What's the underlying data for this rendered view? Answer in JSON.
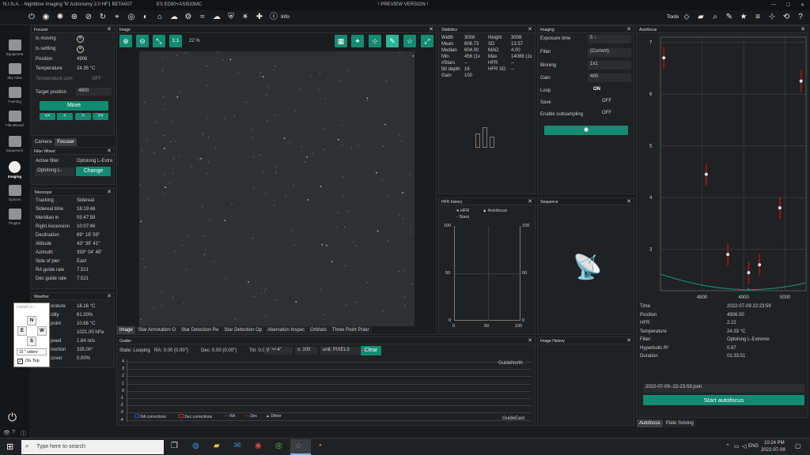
{
  "window": {
    "title": "N.I.N.A. - Nighttime Imaging 'N' Astronomy 2.0 HF1 BETA007",
    "profile": "ES ED80+ASI533MC",
    "banner": "! PREVIEW VERSION !"
  },
  "toolbar": {
    "info_label": "Info",
    "tools_label": "Tools"
  },
  "sidebar": {
    "items": [
      "Equipment",
      "Sky Atlas",
      "Framing",
      "Flat Wizard",
      "Sequencer",
      "Imaging",
      "Options",
      "Plugins"
    ]
  },
  "focuser": {
    "title": "Focuser",
    "rows": [
      {
        "label": "Is moving",
        "value": ""
      },
      {
        "label": "Is settling",
        "value": ""
      },
      {
        "label": "Position",
        "value": "4906"
      },
      {
        "label": "Temperature",
        "value": "24.35 °C"
      },
      {
        "label": "Temperature com",
        "value": "OFF"
      }
    ],
    "target_label": "Target position",
    "target_value": "4800",
    "move_label": "Move",
    "step_buttons": [
      "<<",
      "<",
      ">",
      ">>"
    ]
  },
  "device_tabs": [
    "Camera",
    "Focuser"
  ],
  "filter_wheel": {
    "title": "Filter Wheel",
    "active_label": "Active filter",
    "active_value": "Optolong L-Extre",
    "select_value": "Optolong L-",
    "change_label": "Change"
  },
  "telescope": {
    "title": "Telescope",
    "rows": [
      {
        "label": "Tracking",
        "value": "Sidereal"
      },
      {
        "label": "Sidereal time",
        "value": "16:19:48"
      },
      {
        "label": "Meridian in",
        "value": "05:47:59"
      },
      {
        "label": "Right Ascension",
        "value": "10:07:46"
      },
      {
        "label": "Declination",
        "value": "89° 19' 59\""
      },
      {
        "label": "Altitude",
        "value": "43° 39' 41\""
      },
      {
        "label": "Azimuth",
        "value": "359° 04' 45\""
      },
      {
        "label": "Side of pier",
        "value": "East"
      },
      {
        "label": "RA guide rate",
        "value": "7.521"
      },
      {
        "label": "Dec guide rate",
        "value": "7.521"
      }
    ]
  },
  "weather": {
    "title": "Weather",
    "rows": [
      {
        "label": "erature",
        "value": "18.16 °C"
      },
      {
        "label": "idity",
        "value": "61.00%"
      },
      {
        "label": "point",
        "value": "10.66 °C"
      },
      {
        "label": "",
        "value": "1021.00 hPa"
      },
      {
        "label": "peed",
        "value": "1.64 m/s"
      },
      {
        "label": "irection",
        "value": "335.00°"
      },
      {
        "label": "cover",
        "value": "0.00%"
      }
    ]
  },
  "handcontroller": {
    "title": "HandCo...",
    "buttons": [
      "N",
      "E",
      "W",
      "S"
    ],
    "rate": "15 \" sidere",
    "on_top": "On Top"
  },
  "image": {
    "title": "Image",
    "zoom_label": "1:1",
    "zoom_pct": "22 %",
    "tabs": [
      "Image",
      "Star Annotation O",
      "Star Detection Re",
      "Star Detection Op",
      "Aberration Inspec",
      "Orbitals",
      "Three Point Polar"
    ]
  },
  "statistics": {
    "title": "Statistics",
    "rows": [
      {
        "l1": "Width",
        "v1": "3008",
        "l2": "Height",
        "v2": "3008"
      },
      {
        "l1": "Mean",
        "v1": "606.73",
        "l2": "SD",
        "v2": "13.57"
      },
      {
        "l1": "Median",
        "v1": "604.00",
        "l2": "MAD",
        "v2": "4.00"
      },
      {
        "l1": "Min",
        "v1": "456 (1x",
        "l2": "Max",
        "v2": "14088 (1x"
      },
      {
        "l1": "#Stars",
        "v1": "--",
        "l2": "HFR",
        "v2": "--"
      },
      {
        "l1": "Bit depth",
        "v1": "16",
        "l2": "HFR SD",
        "v2": "--"
      },
      {
        "l1": "Gain",
        "v1": "100",
        "l2": "",
        "v2": ""
      }
    ]
  },
  "imaging": {
    "title": "Imaging",
    "exposure_label": "Exposure time",
    "exposure_value": "5",
    "exposure_unit": "s",
    "filter_label": "Filter",
    "filter_value": "(Current)",
    "binning_label": "Binning",
    "binning_value": "1x1",
    "gain_label": "Gain",
    "gain_value": "400",
    "loop_label": "Loop",
    "loop_value": "ON",
    "save_label": "Save",
    "save_value": "OFF",
    "subsampling_label": "Enable subsampling",
    "subsampling_value": "OFF"
  },
  "hfr_history": {
    "title": "HFR history",
    "legend": [
      "HFR",
      "Autofocus",
      "Stars"
    ],
    "left_ticks": [
      "100",
      "50",
      "0"
    ],
    "right_ticks": [
      "100",
      "50",
      "0"
    ],
    "x_ticks": [
      "0",
      "50",
      "100"
    ]
  },
  "sequence": {
    "title": "Sequence"
  },
  "image_history": {
    "title": "Image History"
  },
  "guider": {
    "title": "Guider",
    "state_label": "State: Looping",
    "ra_label": "RA: 0.00 (0.00\")",
    "dec_label": "Dec: 0.00 (0.00\")",
    "tot_label": "Tot: 0.00 (0.00\")",
    "y_select": "y: +/-4\"",
    "x_select": "x: 100",
    "unit_select": "unit: PIXELS",
    "clear_label": "Clear",
    "y_ticks": [
      "4",
      "3",
      "2",
      "1",
      "0",
      "-1",
      "-2",
      "-3",
      "-4"
    ],
    "north_label": "GuideNorth",
    "east_label": "GuideEast",
    "legend": [
      "RA corrections",
      "Dec corrections",
      "RA",
      "Dec",
      "Dither"
    ]
  },
  "autofocus": {
    "title": "Autofocus",
    "info": [
      {
        "label": "Time",
        "value": "2022-07-09 22:23:59"
      },
      {
        "label": "Position",
        "value": "4906.00"
      },
      {
        "label": "HFR",
        "value": "2.22"
      },
      {
        "label": "Temperature",
        "value": "24.33 °C"
      },
      {
        "label": "Filter",
        "value": "Optolong L-Extreme"
      },
      {
        "label": "Hyperbolic R²",
        "value": "0.97"
      },
      {
        "label": "Duration",
        "value": "01:33.51"
      }
    ],
    "file_select": "2022-07-09--22-23-59.json",
    "start_label": "Start autofocus",
    "tabs": [
      "Autofocus",
      "Plate Solving"
    ]
  },
  "chart_data": {
    "type": "scatter",
    "title": "",
    "x_ticks": [
      "4800",
      "4900",
      "5000"
    ],
    "y_ticks": [
      "7",
      "6",
      "5",
      "4",
      "3"
    ],
    "xlim": [
      4700,
      5050
    ],
    "ylim": [
      2.2,
      7.1
    ],
    "series": [
      {
        "x": [
          4708,
          4810,
          4862,
          4912,
          4938,
          4987,
          5038
        ],
        "y": [
          6.7,
          4.45,
          2.9,
          2.55,
          2.7,
          3.8,
          6.25
        ]
      }
    ],
    "fit_min": {
      "x": 4912,
      "y": 2.22
    }
  },
  "taskbar": {
    "search_placeholder": "Type here to search",
    "lang": "ENG",
    "time": "10:24 PM",
    "date": "2022-07-09"
  },
  "colors": {
    "accent": "#138a72",
    "background": "#1f2123",
    "error_bar": "#8b1a1a"
  }
}
